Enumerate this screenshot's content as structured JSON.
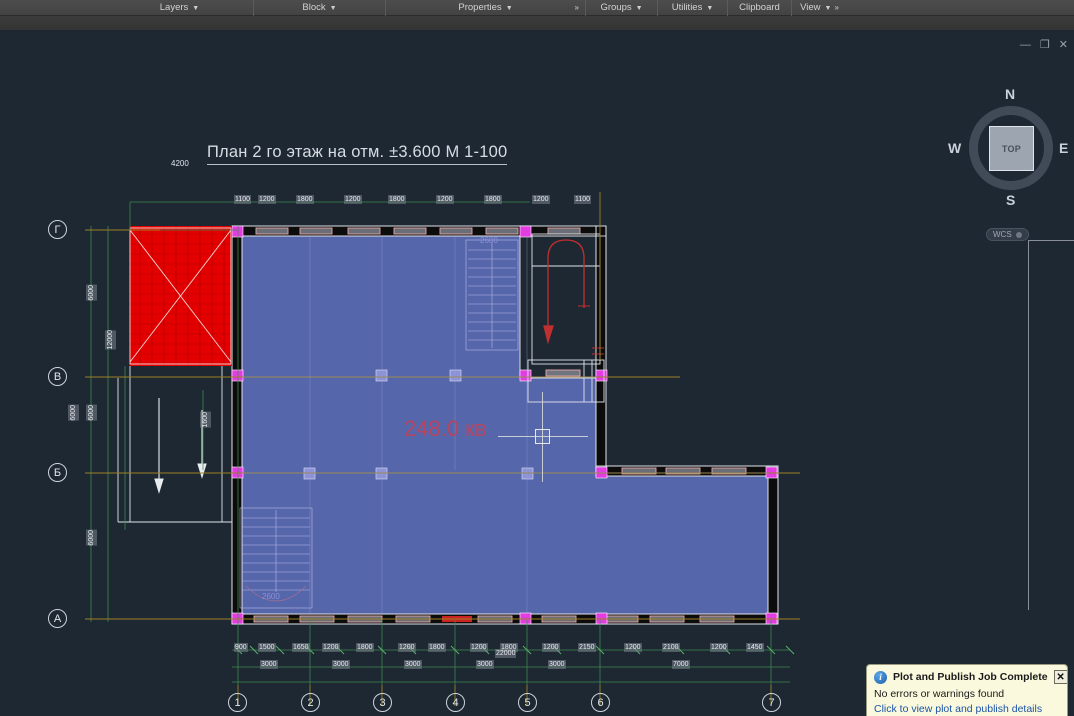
{
  "ribbon": {
    "panels": [
      {
        "label": "Layers",
        "caret": true,
        "overflow": false
      },
      {
        "label": "Block",
        "caret": true,
        "overflow": false
      },
      {
        "label": "Properties",
        "caret": true,
        "overflow": true
      },
      {
        "label": "Groups",
        "caret": true,
        "overflow": false
      },
      {
        "label": "Utilities",
        "caret": true,
        "overflow": false
      },
      {
        "label": "Clipboard",
        "caret": false,
        "overflow": false
      },
      {
        "label": "View",
        "caret": true,
        "overflow": true
      }
    ]
  },
  "window_controls": {
    "minimize": "—",
    "restore": "❐",
    "close": "✕"
  },
  "viewcube": {
    "face": "TOP",
    "north": "N",
    "east": "E",
    "south": "S",
    "west": "W"
  },
  "ucs": {
    "label": "WCS"
  },
  "drawing": {
    "title": "План 2 го этаж на отм. ±3.600 М 1-100",
    "area_label": "248.0 кв",
    "stair_label_top": "2600",
    "stair_label_bottom": "2600",
    "offset_dim": "4200",
    "grid_marks_bottom": [
      "1",
      "2",
      "3",
      "4",
      "5",
      "6",
      "7"
    ],
    "grid_marks_left": [
      "Г",
      "В",
      "Б",
      "А"
    ],
    "dims_top": [
      "1100",
      "1200",
      "1800",
      "1200",
      "1800",
      "1200",
      "1800",
      "1200",
      "1100"
    ],
    "dims_bottom_inner": [
      "900",
      "1500",
      "1650",
      "1200",
      "1800",
      "1200",
      "1800",
      "1200",
      "1800",
      "1200",
      "2150",
      "1200",
      "2100",
      "1200",
      "1450"
    ],
    "dims_bottom_bays": [
      "3000",
      "3000",
      "3000",
      "3000",
      "3000",
      "7000"
    ],
    "dims_bottom_total": "22000",
    "dims_left_inner": [
      "6000",
      "6000",
      "6000",
      "6000"
    ],
    "dims_left_total": "12000",
    "dims_left_mid": "1600"
  },
  "notification": {
    "title": "Plot and Publish Job Complete",
    "message": "No errors or warnings found",
    "link": "Click to view plot and publish details",
    "close": "✕",
    "icon": "i"
  },
  "colors": {
    "slab_fill": "#5b6bb5",
    "hatch_red": "#e00000",
    "grid_green": "#3f8f4e",
    "grid_yellow": "#9c8024",
    "grip_magenta": "#e040e0",
    "canvas_bg": "#1e2833"
  }
}
